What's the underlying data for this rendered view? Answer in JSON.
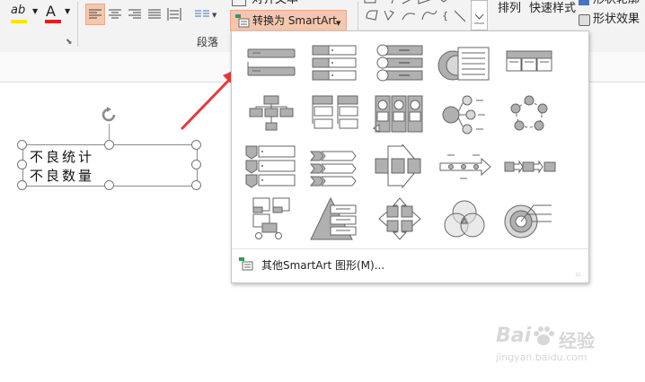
{
  "ribbon": {
    "align_text_label": "对齐文本",
    "convert_smartart_label": "转换为 SmartArt",
    "paragraph_group_label": "段落",
    "arrange_label": "排列",
    "quick_styles_label": "快速样式",
    "shape_outline_label": "形状轮廓",
    "shape_effects_label": "形状效果",
    "font_color_letter": "A",
    "highlight_letter": "ab"
  },
  "textbox": {
    "line1": "不良统计",
    "line2": "不良数量"
  },
  "smartart_menu": {
    "more_label": "其他SmartArt 图形(M)..."
  },
  "watermark": {
    "brand": "Bai",
    "brand2": "经验",
    "url": "jingyan.baidu.com"
  },
  "colors": {
    "accent_orange": "#f4c7ae",
    "arrow_red": "#e23b3b",
    "font_red": "#e02020",
    "highlight_yellow": "#ffe400",
    "shape_gray": "#b0b0b0"
  }
}
